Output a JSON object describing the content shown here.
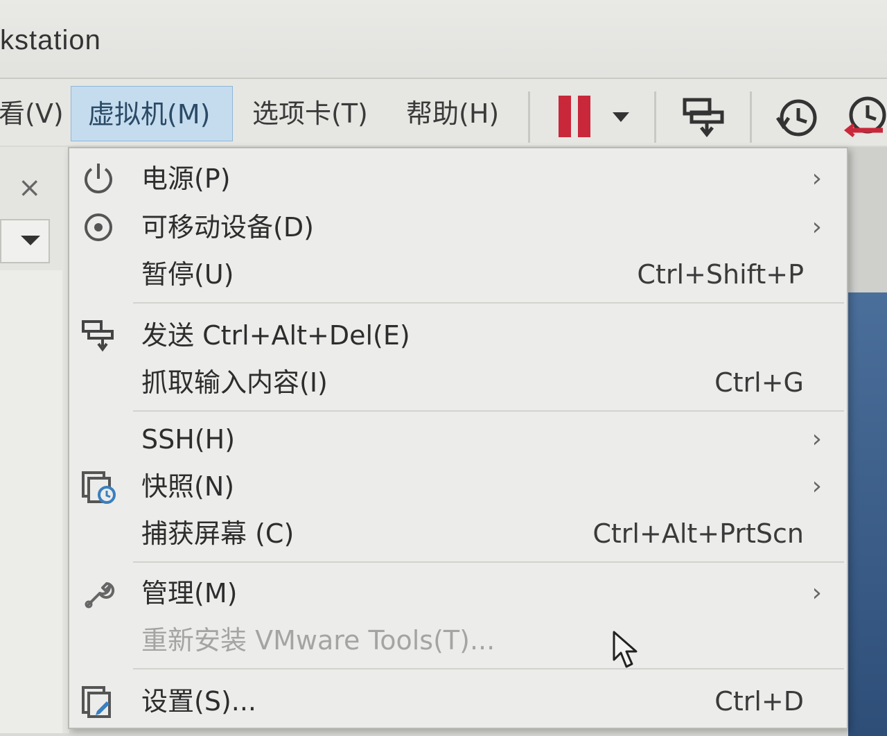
{
  "window": {
    "title": "kstation"
  },
  "menubar": {
    "items": [
      {
        "label": "看(V)"
      },
      {
        "label": "虚拟机(M)"
      },
      {
        "label": "选项卡(T)"
      },
      {
        "label": "帮助(H)"
      }
    ]
  },
  "toolbar": {
    "icons": [
      "pause-icon",
      "dropdown-arrow-icon",
      "send-ctrl-alt-del-icon",
      "snapshot-icon",
      "revert-snapshot-icon"
    ]
  },
  "side_panel": {
    "close_glyph": "×"
  },
  "vm_menu": {
    "items": [
      {
        "label": "电源(P)",
        "icon": "power-icon",
        "submenu": "›"
      },
      {
        "label": "可移动设备(D)",
        "icon": "disc-icon",
        "submenu": "›"
      },
      {
        "label": "暂停(U)",
        "shortcut": "Ctrl+Shift+P"
      },
      {
        "label": "发送 Ctrl+Alt+Del(E)",
        "icon": "send-keys-icon"
      },
      {
        "label": "抓取输入内容(I)",
        "shortcut": "Ctrl+G"
      },
      {
        "label": "SSH(H)",
        "submenu": "›"
      },
      {
        "label": "快照(N)",
        "icon": "snapshot-icon",
        "submenu": "›"
      },
      {
        "label": "捕获屏幕 (C)",
        "shortcut": "Ctrl+Alt+PrtScn"
      },
      {
        "label": "管理(M)",
        "icon": "wrench-icon",
        "submenu": "›"
      },
      {
        "label": "重新安装 VMware Tools(T)...",
        "disabled": true
      },
      {
        "label": "设置(S)...",
        "icon": "settings-icon",
        "shortcut": "Ctrl+D"
      }
    ]
  },
  "colors": {
    "active_menu_bg": "#c5dcef",
    "pause_red": "#c8283a",
    "disabled_text": "#a4a4a2"
  }
}
